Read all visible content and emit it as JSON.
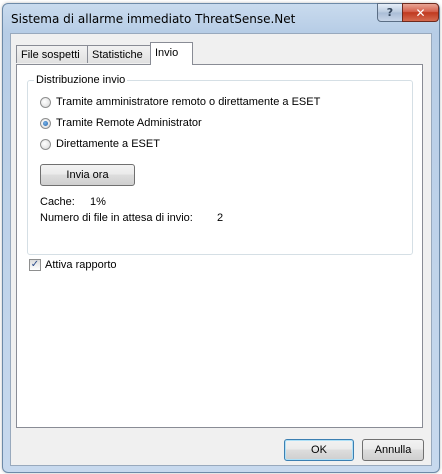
{
  "window": {
    "title": "Sistema di allarme immediato ThreatSense.Net",
    "help_glyph": "?",
    "close_glyph": "✕"
  },
  "tabs": [
    {
      "label": "File sospetti",
      "active": false
    },
    {
      "label": "Statistiche",
      "active": false
    },
    {
      "label": "Invio",
      "active": true
    }
  ],
  "distribution": {
    "group_title": "Distribuzione invio",
    "options": [
      {
        "label": "Tramite amministratore remoto o direttamente a ESET",
        "selected": false
      },
      {
        "label": "Tramite Remote Administrator",
        "selected": true
      },
      {
        "label": "Direttamente a ESET",
        "selected": false
      }
    ],
    "send_now_button": "Invia ora",
    "cache_label": "Cache:",
    "cache_value": "1%",
    "pending_label": "Numero di file in attesa di invio:",
    "pending_value": "2"
  },
  "enable_logging": {
    "label": "Attiva rapporto",
    "checked": true,
    "check_glyph": "✓"
  },
  "footer": {
    "ok_label": "OK",
    "cancel_label": "Annulla"
  }
}
